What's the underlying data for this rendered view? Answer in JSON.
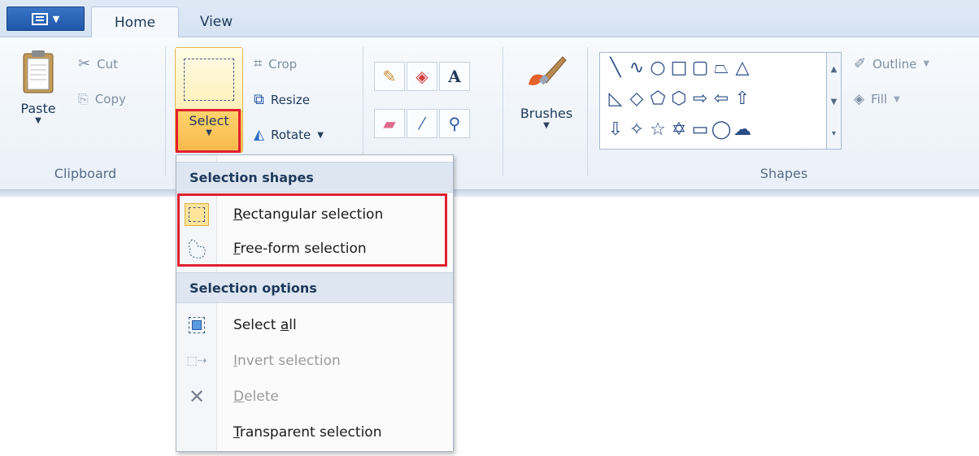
{
  "tabs": {
    "home": "Home",
    "view": "View"
  },
  "clipboard": {
    "paste": "Paste",
    "cut": "Cut",
    "copy": "Copy",
    "group_label": "Clipboard"
  },
  "image": {
    "select": "Select",
    "crop": "Crop",
    "resize": "Resize",
    "rotate": "Rotate"
  },
  "brushes": {
    "label": "Brushes"
  },
  "shapes": {
    "outline": "Outline",
    "fill": "Fill",
    "group_label": "Shapes",
    "gallery": [
      "line",
      "curve",
      "oval",
      "rectangle",
      "rounded-rectangle",
      "polygon",
      "triangle",
      "right-triangle",
      "diamond",
      "pentagon",
      "hexagon",
      "right-arrow",
      "left-arrow",
      "up-arrow",
      "down-arrow",
      "four-point-star",
      "five-point-star",
      "six-point-star",
      "rounded-callout",
      "oval-callout",
      "cloud-callout"
    ]
  },
  "menu": {
    "header_shapes": "Selection shapes",
    "rect_first": "R",
    "rect_rest": "ectangular selection",
    "free_first": "F",
    "free_rest": "ree-form selection",
    "header_options": "Selection options",
    "selectall_pre": "Select ",
    "selectall_u": "a",
    "selectall_post": "ll",
    "invert_first": "I",
    "invert_rest": "nvert selection",
    "delete_first": "D",
    "delete_rest": "elete",
    "transparent_first": "T",
    "transparent_rest": "ransparent selection"
  },
  "colors": {
    "accent": "#1f58aa",
    "highlight": "#e02030",
    "select_active": "#ffd36e"
  }
}
